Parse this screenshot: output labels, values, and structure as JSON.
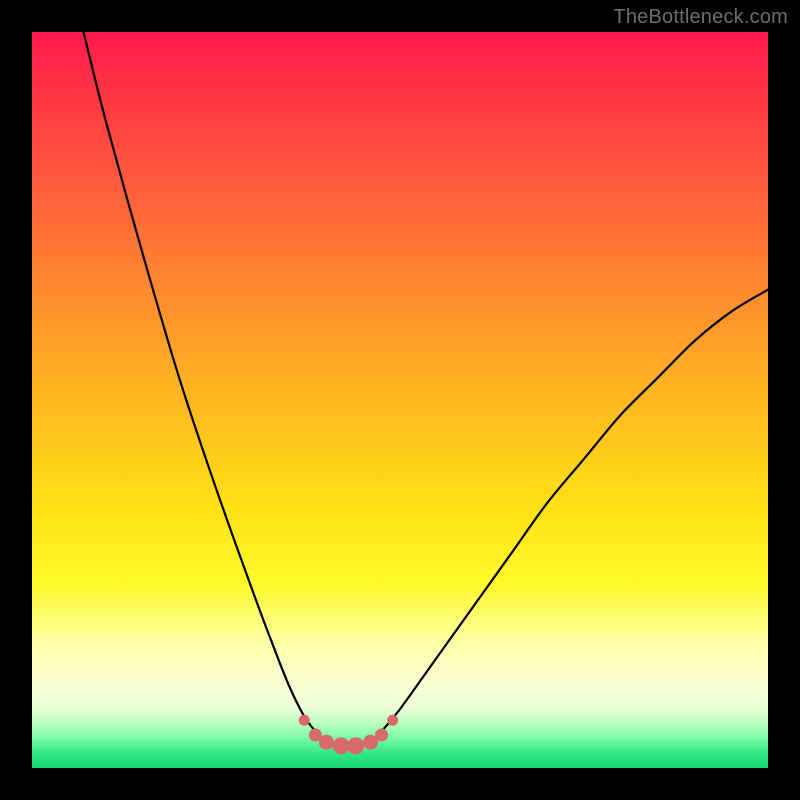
{
  "attribution": "TheBottleneck.com",
  "colors": {
    "frame": "#000000",
    "curve_stroke": "#000000",
    "marker_fill": "#d86a6a",
    "gradient_stops": [
      "#ff1a4d",
      "#ff3344",
      "#ff5a3e",
      "#ff8a2f",
      "#ffb820",
      "#ffe215",
      "#fff92b",
      "#fdffa6",
      "#fbffd0",
      "#eaffd8",
      "#9bffb0",
      "#33e986",
      "#16d679"
    ]
  },
  "chart_data": {
    "type": "line",
    "title": "",
    "xlabel": "",
    "ylabel": "",
    "xlim": [
      0,
      100
    ],
    "ylim": [
      0,
      100
    ],
    "annotations": [],
    "series": [
      {
        "name": "bottleneck-curve-left",
        "x": [
          7,
          10,
          15,
          20,
          25,
          30,
          33,
          35,
          37,
          38.5
        ],
        "values": [
          100,
          88,
          70,
          53,
          38,
          24,
          16,
          11,
          7,
          5
        ]
      },
      {
        "name": "bottleneck-curve-floor",
        "x": [
          38.5,
          40,
          42,
          44,
          46,
          47.5
        ],
        "values": [
          5,
          3.5,
          3,
          3,
          3.5,
          5
        ]
      },
      {
        "name": "bottleneck-curve-right",
        "x": [
          47.5,
          50,
          55,
          60,
          65,
          70,
          75,
          80,
          85,
          90,
          95,
          100
        ],
        "values": [
          5,
          8,
          15,
          22,
          29,
          36,
          42,
          48,
          53,
          58,
          62,
          65
        ]
      },
      {
        "name": "bottleneck-markers",
        "x": [
          37,
          38.5,
          40,
          42,
          44,
          46,
          47.5,
          49
        ],
        "values": [
          6.5,
          4.5,
          3.5,
          3,
          3,
          3.5,
          4.5,
          6.5
        ]
      }
    ]
  }
}
